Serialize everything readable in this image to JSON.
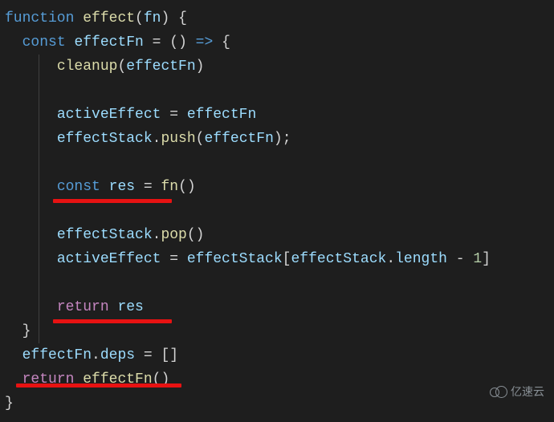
{
  "code": {
    "line1": {
      "kw_function": "function",
      "fn_name": "effect",
      "paren_open": "(",
      "param": "fn",
      "paren_close": ")",
      "brace": " {"
    },
    "line2": {
      "kw_const": "const",
      "var_effectFn": "effectFn",
      "eq": " = ",
      "arrow_params": "()",
      "arrow": " => ",
      "brace": "{"
    },
    "line3": {
      "fn_cleanup": "cleanup",
      "paren_open": "(",
      "arg": "effectFn",
      "paren_close": ")"
    },
    "line4": "",
    "line5": {
      "var_activeEffect": "activeEffect",
      "eq": " = ",
      "var_effectFn": "effectFn"
    },
    "line6": {
      "var_effectStack": "effectStack",
      "dot": ".",
      "fn_push": "push",
      "paren_open": "(",
      "arg": "effectFn",
      "paren_close_semi": ");"
    },
    "line7": "",
    "line8": {
      "kw_const": "const",
      "var_res": "res",
      "eq": " = ",
      "fn_fn": "fn",
      "parens": "()"
    },
    "line9": "",
    "line10": {
      "var_effectStack": "effectStack",
      "dot": ".",
      "fn_pop": "pop",
      "parens": "()"
    },
    "line11": {
      "var_activeEffect": "activeEffect",
      "eq": " = ",
      "var_effectStack": "effectStack",
      "bracket_open": "[",
      "var_effectStack2": "effectStack",
      "dot": ".",
      "prop_length": "length",
      "minus": " - ",
      "num_1": "1",
      "bracket_close": "]"
    },
    "line12": "",
    "line13": {
      "kw_return": "return",
      "var_res": "res"
    },
    "line14": {
      "brace": "}"
    },
    "line15": {
      "var_effectFn": "effectFn",
      "dot": ".",
      "prop_deps": "deps",
      "eq": " = ",
      "brackets": "[]"
    },
    "line16": {
      "kw_return": "return",
      "fn_effectFn": "effectFn",
      "parens": "()"
    },
    "line17": {
      "brace": "}"
    }
  },
  "watermark_text": "亿速云"
}
